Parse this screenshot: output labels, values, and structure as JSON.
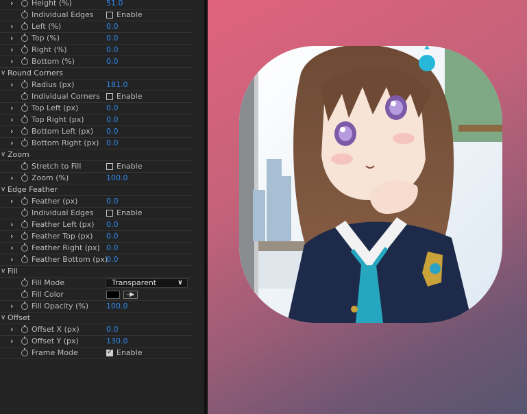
{
  "panel": {
    "rows": [
      {
        "type": "prop",
        "expand": true,
        "label": "Height (%)",
        "value": "51.0"
      },
      {
        "type": "check",
        "label": "Individual Edges",
        "check_label": "Enable",
        "checked": false
      },
      {
        "type": "prop",
        "expand": true,
        "label": "Left (%)",
        "value": "0.0"
      },
      {
        "type": "prop",
        "expand": true,
        "label": "Top (%)",
        "value": "0.0"
      },
      {
        "type": "prop",
        "expand": true,
        "label": "Right (%)",
        "value": "0.0"
      },
      {
        "type": "prop",
        "expand": true,
        "label": "Bottom (%)",
        "value": "0.0"
      },
      {
        "type": "section",
        "label": "Round Corners"
      },
      {
        "type": "prop",
        "expand": true,
        "label": "Radius (px)",
        "value": "181.0"
      },
      {
        "type": "check",
        "label": "Individual Corners",
        "check_label": "Enable",
        "checked": false
      },
      {
        "type": "prop",
        "expand": true,
        "label": "Top Left (px)",
        "value": "0.0"
      },
      {
        "type": "prop",
        "expand": true,
        "label": "Top Right (px)",
        "value": "0.0"
      },
      {
        "type": "prop",
        "expand": true,
        "label": "Bottom Left (px)",
        "value": "0.0"
      },
      {
        "type": "prop",
        "expand": true,
        "label": "Bottom Right (px)",
        "value": "0.0"
      },
      {
        "type": "section",
        "label": "Zoom"
      },
      {
        "type": "check",
        "label": "Stretch to Fill",
        "check_label": "Enable",
        "checked": false
      },
      {
        "type": "prop",
        "expand": true,
        "label": "Zoom (%)",
        "value": "100.0"
      },
      {
        "type": "section",
        "label": "Edge Feather"
      },
      {
        "type": "prop",
        "expand": true,
        "label": "Feather (px)",
        "value": "0.0"
      },
      {
        "type": "check",
        "label": "Individual Edges",
        "check_label": "Enable",
        "checked": false
      },
      {
        "type": "prop",
        "expand": true,
        "label": "Feather Left (px)",
        "value": "0.0"
      },
      {
        "type": "prop",
        "expand": true,
        "label": "Feather Top (px)",
        "value": "0.0"
      },
      {
        "type": "prop",
        "expand": true,
        "label": "Feather Right (px)",
        "value": "0.0"
      },
      {
        "type": "prop",
        "expand": true,
        "label": "Feather Bottom (px)",
        "value": "0.0"
      },
      {
        "type": "section",
        "label": "Fill"
      },
      {
        "type": "dropdown",
        "label": "Fill Mode",
        "value": "Transparent"
      },
      {
        "type": "color",
        "label": "Fill Color",
        "color": "#000000"
      },
      {
        "type": "prop",
        "expand": true,
        "label": "Fill Opacity (%)",
        "value": "100.0"
      },
      {
        "type": "section",
        "label": "Offset"
      },
      {
        "type": "prop",
        "expand": true,
        "label": "Offset X (px)",
        "value": "0.0"
      },
      {
        "type": "prop",
        "expand": true,
        "label": "Offset Y (px)",
        "value": "130.0"
      },
      {
        "type": "check",
        "label": "Frame Mode",
        "check_label": "Enable",
        "checked": true
      }
    ]
  },
  "viewer": {
    "image_subject": "anime-girl-illustration"
  },
  "colors": {
    "panel_bg": "#232323",
    "value_blue": "#2f8cf0",
    "bg_gradient_start": "#e0637c",
    "bg_gradient_end": "#575570"
  }
}
